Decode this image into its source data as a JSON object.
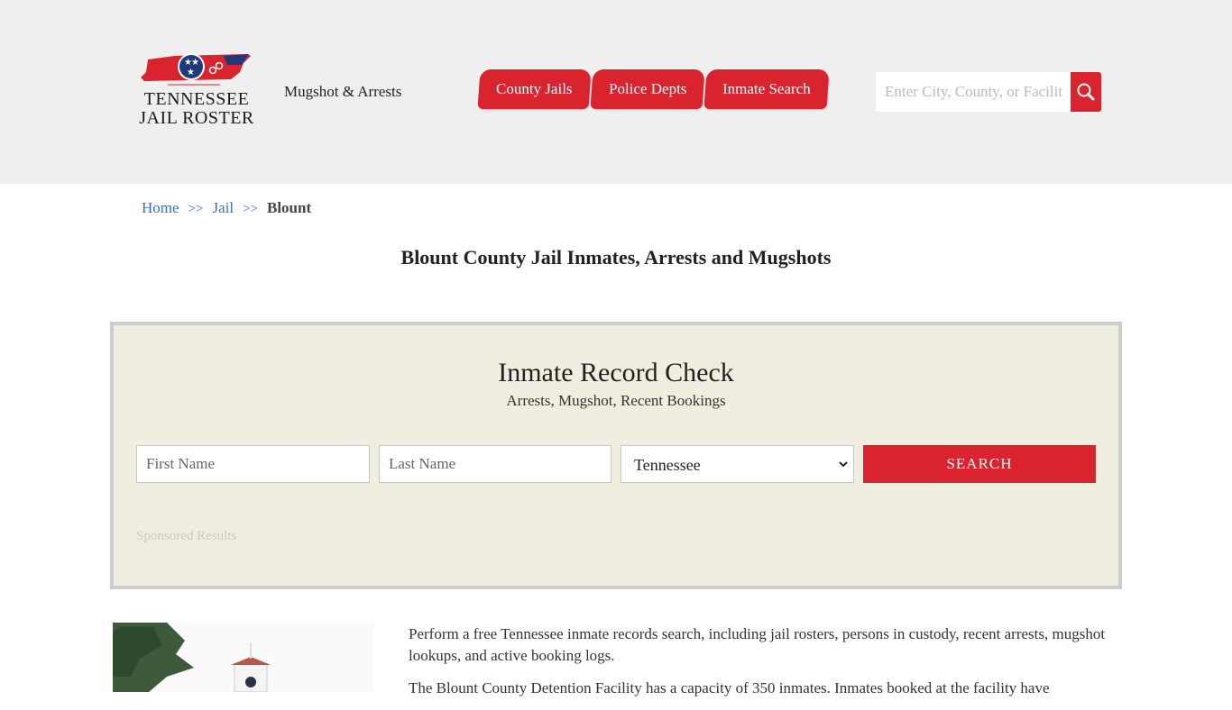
{
  "site": {
    "logo_line1": "TENNESSEE",
    "logo_line2": "JAIL ROSTER",
    "tagline": "Mugshot & Arrests",
    "colors": {
      "brand_red": "#d9232e",
      "brand_blue": "#1f3a7a",
      "link_blue": "#3a6fc8",
      "panel_bg": "#f0eee0",
      "header_bg": "#efefef"
    }
  },
  "nav": {
    "tabs": [
      {
        "label": "County Jails"
      },
      {
        "label": "Police Depts"
      },
      {
        "label": "Inmate Search"
      }
    ]
  },
  "search": {
    "placeholder": "Enter City, County, or Facility",
    "icon": "search-icon"
  },
  "breadcrumb": {
    "items": [
      {
        "label": "Home"
      },
      {
        "label": "Jail"
      },
      {
        "label": "Blount"
      }
    ],
    "separator": ">>"
  },
  "page": {
    "title": "Blount County Jail Inmates, Arrests and Mugshots"
  },
  "record_check": {
    "title": "Inmate Record Check",
    "subtitle": "Arrests, Mugshot, Recent Bookings",
    "first_name_placeholder": "First Name",
    "last_name_placeholder": "Last Name",
    "state_selected": "Tennessee",
    "search_label": "SEARCH",
    "sponsored_label": "Sponsored Results"
  },
  "content": {
    "paragraphs": [
      "Perform a free Tennessee inmate records search, including jail rosters, persons in custody, recent arrests, mugshot lookups, and active booking logs.",
      "The Blount County Detention Facility has a capacity of 350 inmates. Inmates booked at the facility have"
    ]
  }
}
